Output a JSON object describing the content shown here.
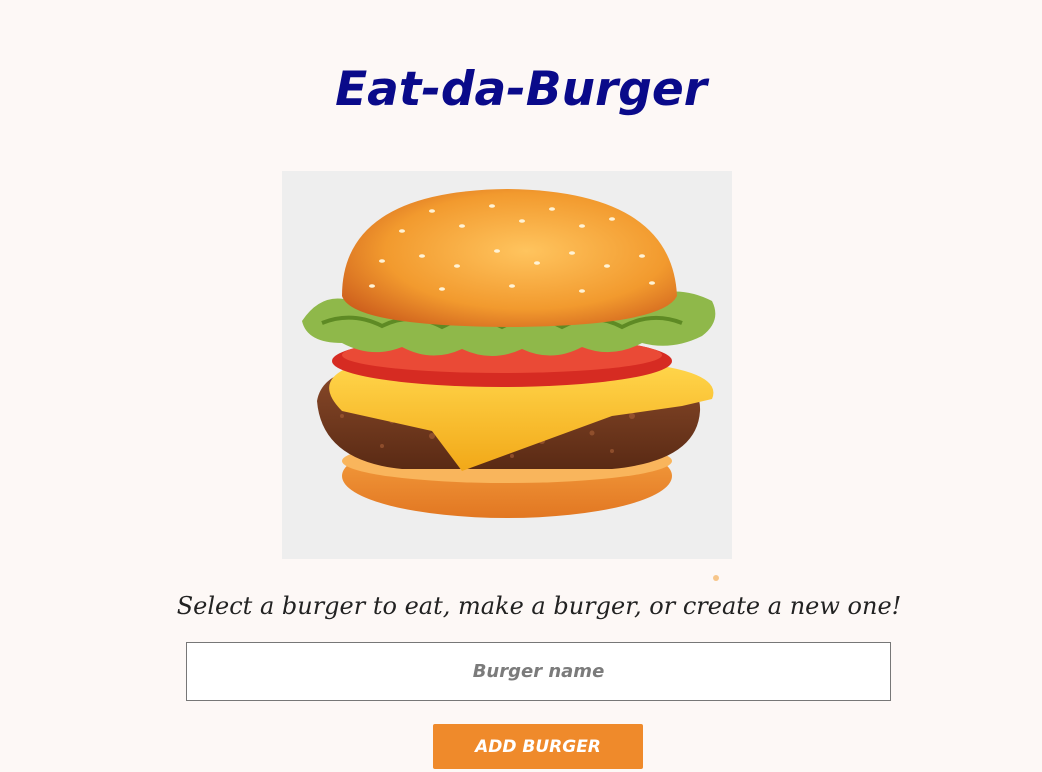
{
  "header": {
    "title": "Eat-da-Burger"
  },
  "hero": {
    "image_icon": "burger-illustration"
  },
  "main": {
    "instructions": "Select a burger to eat, make a burger, or create a new one!",
    "burger_input": {
      "placeholder": "Burger name",
      "value": ""
    },
    "add_button_label": "ADD BURGER"
  },
  "colors": {
    "background": "#fdf8f6",
    "title": "#0a0a8a",
    "button": "#ef8a2b",
    "image_bg": "#eeeeee"
  }
}
